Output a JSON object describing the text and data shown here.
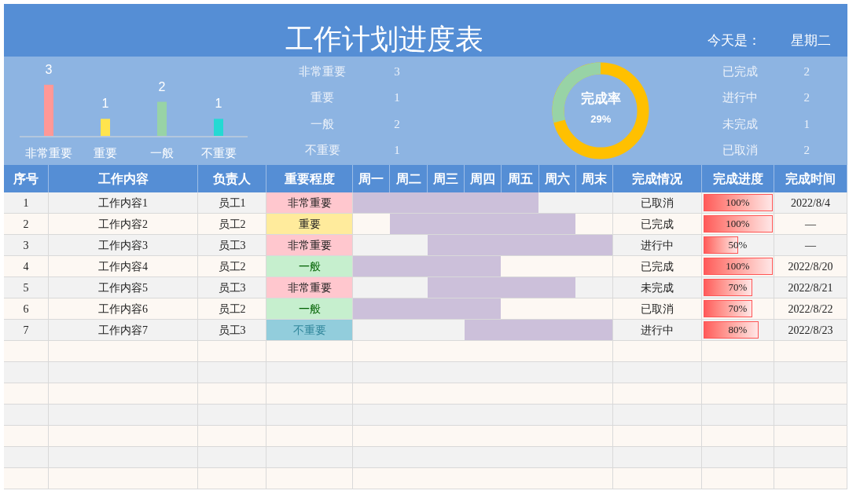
{
  "title": "工作计划进度表",
  "today_label": "今天是：",
  "today_value": "星期二",
  "importance_chart": {
    "chart_data": {
      "type": "bar",
      "categories": [
        "非常重要",
        "重要",
        "一般",
        "不重要"
      ],
      "data_labels": true,
      "series": [
        {
          "values": [
            3,
            1,
            2,
            1
          ]
        }
      ],
      "colors": [
        "#ff9896",
        "#ffe44d",
        "#98d3a6",
        "#25d9d3"
      ]
    }
  },
  "importance_counts": [
    {
      "label": "非常重要",
      "value": "3"
    },
    {
      "label": "重要",
      "value": "1"
    },
    {
      "label": "一般",
      "value": "2"
    },
    {
      "label": "不重要",
      "value": "1"
    }
  ],
  "completion_gauge": {
    "label": "完成率",
    "value": "29%",
    "level": 0.29
  },
  "status_counts": [
    {
      "label": "已完成",
      "value": "2"
    },
    {
      "label": "进行中",
      "value": "2"
    },
    {
      "label": "未完成",
      "value": "1"
    },
    {
      "label": "已取消",
      "value": "2"
    }
  ],
  "table": {
    "columns": [
      "序号",
      "工作内容",
      "负责人",
      "重要程度",
      "周一",
      "周二",
      "周三",
      "周四",
      "周五",
      "周六",
      "周末",
      "完成情况",
      "完成进度",
      "完成时间"
    ],
    "rows": [
      {
        "no": "1",
        "task": "工作内容1",
        "owner": "员工1",
        "importance": {
          "text": "非常重要",
          "kind": "critical"
        },
        "days": [
          true,
          true,
          true,
          true,
          true,
          false,
          false
        ],
        "status": "已取消",
        "progress": "100%",
        "level": 1,
        "date": "2022/8/4"
      },
      {
        "no": "2",
        "task": "工作内容2",
        "owner": "员工2",
        "importance": {
          "text": "重要",
          "kind": "high"
        },
        "days": [
          false,
          true,
          true,
          true,
          true,
          true,
          false
        ],
        "status": "已完成",
        "progress": "100%",
        "level": 1,
        "date": "—"
      },
      {
        "no": "3",
        "task": "工作内容3",
        "owner": "员工3",
        "importance": {
          "text": "非常重要",
          "kind": "critical"
        },
        "days": [
          false,
          false,
          true,
          true,
          true,
          true,
          true
        ],
        "status": "进行中",
        "progress": "50%",
        "level": 0.5,
        "date": "—"
      },
      {
        "no": "4",
        "task": "工作内容4",
        "owner": "员工2",
        "importance": {
          "text": "一般",
          "kind": "normal"
        },
        "days": [
          true,
          true,
          true,
          true,
          false,
          false,
          false
        ],
        "status": "已完成",
        "progress": "100%",
        "level": 1,
        "date": "2022/8/20"
      },
      {
        "no": "5",
        "task": "工作内容5",
        "owner": "员工3",
        "importance": {
          "text": "非常重要",
          "kind": "critical"
        },
        "days": [
          false,
          false,
          true,
          true,
          true,
          true,
          false
        ],
        "status": "未完成",
        "progress": "70%",
        "level": 0.7,
        "date": "2022/8/21"
      },
      {
        "no": "6",
        "task": "工作内容6",
        "owner": "员工2",
        "importance": {
          "text": "一般",
          "kind": "normal"
        },
        "days": [
          true,
          true,
          true,
          true,
          false,
          false,
          false
        ],
        "status": "已取消",
        "progress": "70%",
        "level": 0.7,
        "date": "2022/8/22"
      },
      {
        "no": "7",
        "task": "工作内容7",
        "owner": "员工3",
        "importance": {
          "text": "不重要",
          "kind": "low"
        },
        "days": [
          false,
          false,
          false,
          true,
          true,
          true,
          true
        ],
        "status": "进行中",
        "progress": "80%",
        "level": 0.8,
        "date": "2022/8/23"
      }
    ]
  }
}
